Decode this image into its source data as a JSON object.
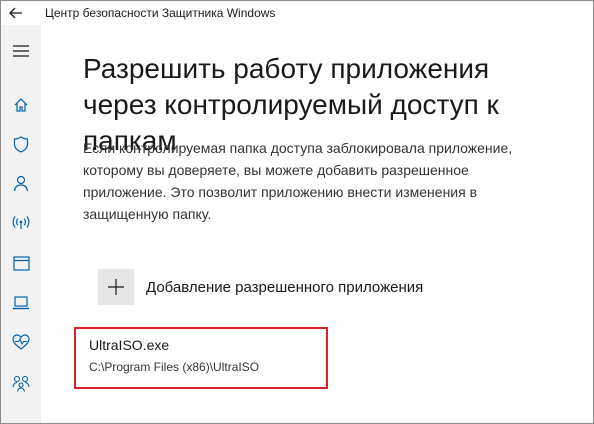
{
  "titlebar": {
    "title": "Центр безопасности Защитника Windows",
    "back_icon": "back-arrow-icon"
  },
  "sidebar": {
    "items": [
      {
        "name": "menu",
        "icon": "hamburger-icon"
      },
      {
        "name": "home",
        "icon": "home-icon"
      },
      {
        "name": "virus-protection",
        "icon": "shield-icon"
      },
      {
        "name": "account-protection",
        "icon": "person-icon"
      },
      {
        "name": "firewall-network",
        "icon": "wireless-icon"
      },
      {
        "name": "app-browser-control",
        "icon": "browser-window-icon"
      },
      {
        "name": "device-security",
        "icon": "laptop-icon"
      },
      {
        "name": "device-performance",
        "icon": "heart-icon"
      },
      {
        "name": "family-options",
        "icon": "family-icon"
      }
    ]
  },
  "main": {
    "title": "Разрешить работу приложения через контролируемый доступ к папкам",
    "description": "Если контролируемая папка доступа заблокировала приложение, которому вы доверяете, вы можете добавить разрешенное приложение. Это позволит приложению внести изменения в защищенную папку.",
    "add_button_label": "Добавление разрешенного приложения",
    "add_icon": "plus-icon",
    "allowed_apps": [
      {
        "name": "UltraISO.exe",
        "path": "C:\\Program Files (x86)\\UltraISO"
      }
    ]
  },
  "colors": {
    "accent": "#0063b1",
    "highlight_border": "#d9222a",
    "sidebar_bg": "#f2f2f2",
    "add_button_bg": "#e6e6e6"
  }
}
